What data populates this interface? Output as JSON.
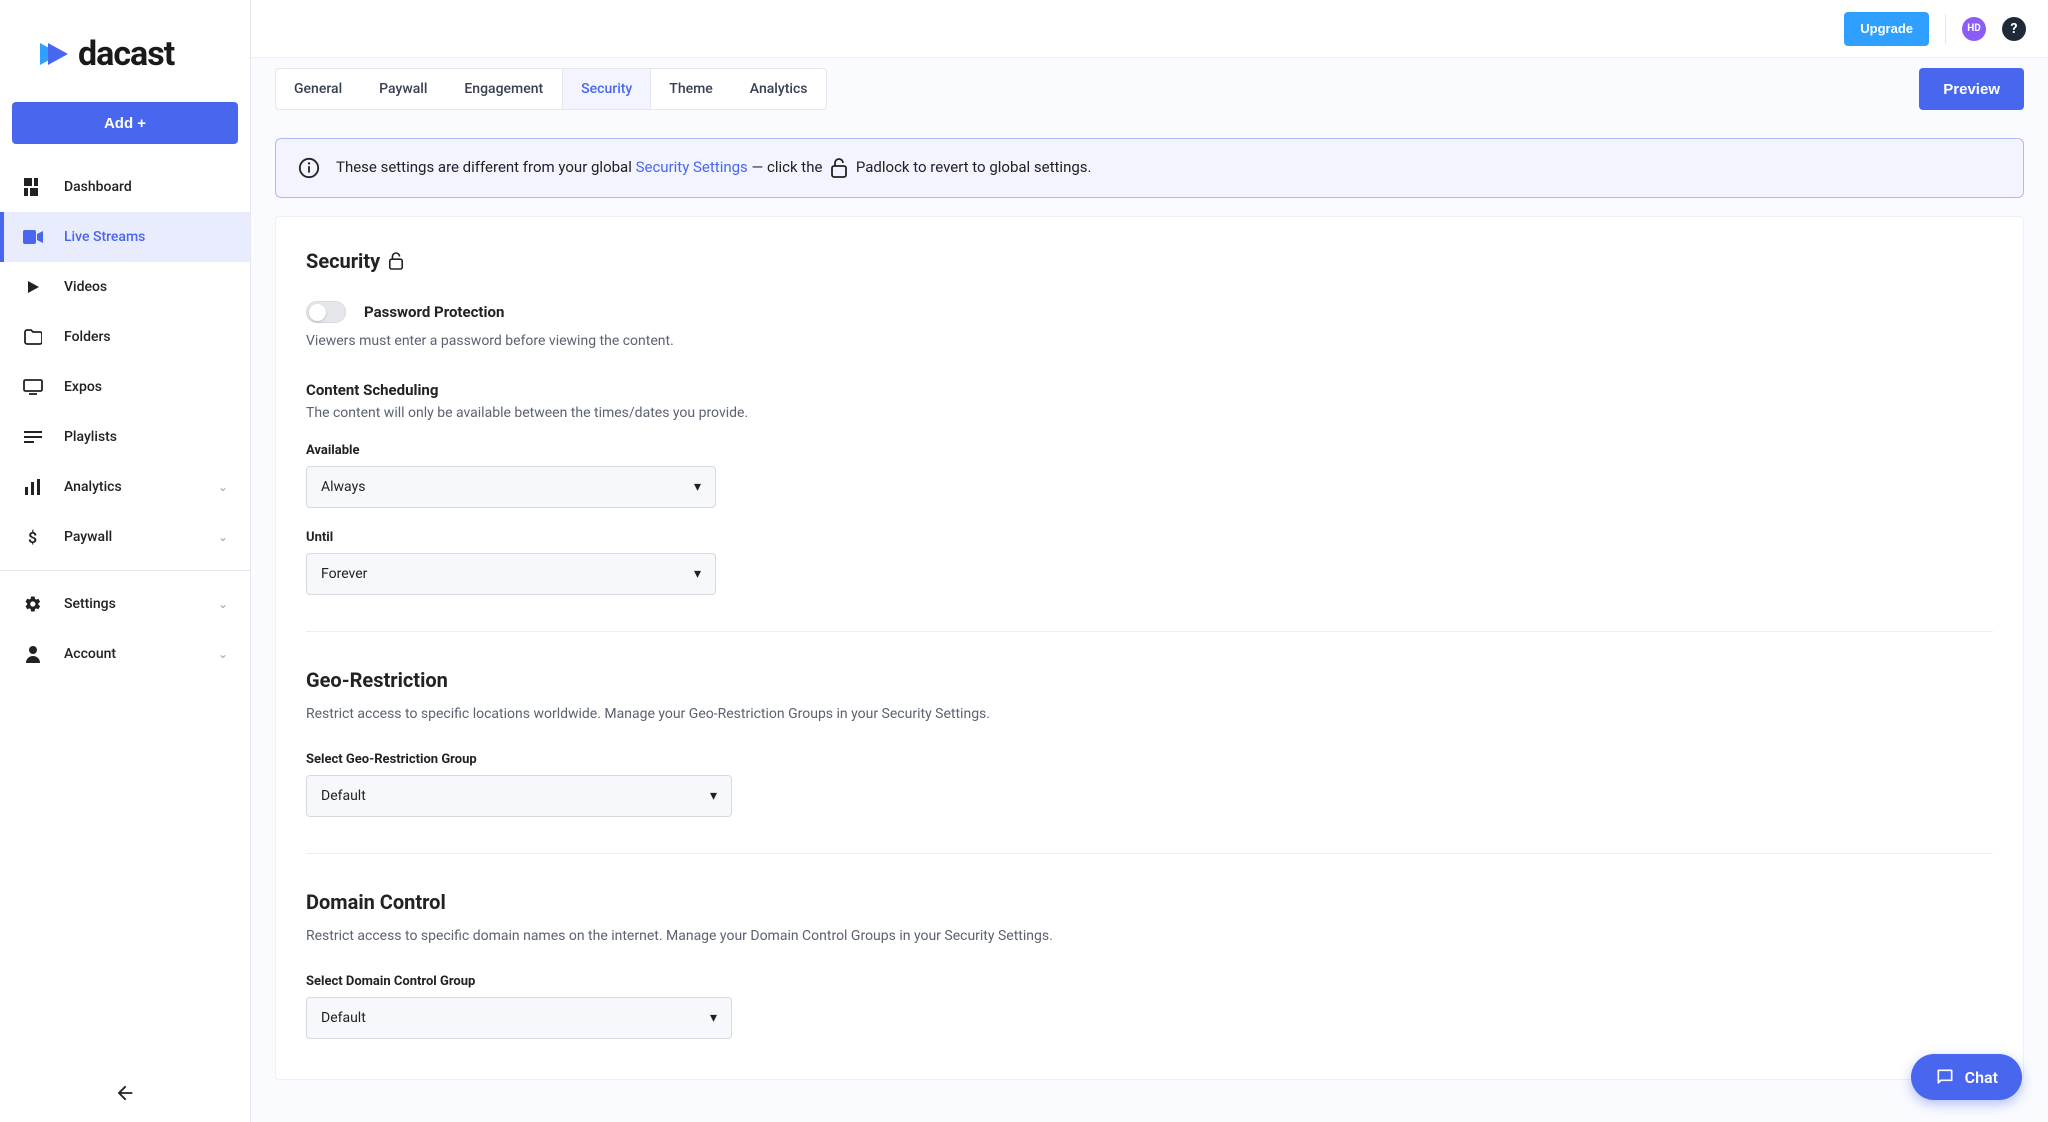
{
  "brand": {
    "name": "dacast"
  },
  "sidebar": {
    "add_label": "Add +",
    "items": [
      {
        "label": "Dashboard"
      },
      {
        "label": "Live Streams"
      },
      {
        "label": "Videos"
      },
      {
        "label": "Folders"
      },
      {
        "label": "Expos"
      },
      {
        "label": "Playlists"
      },
      {
        "label": "Analytics"
      },
      {
        "label": "Paywall"
      }
    ],
    "bottom_items": [
      {
        "label": "Settings"
      },
      {
        "label": "Account"
      }
    ]
  },
  "topbar": {
    "upgrade_label": "Upgrade",
    "avatar_initials": "HD"
  },
  "tabs": [
    {
      "label": "General"
    },
    {
      "label": "Paywall"
    },
    {
      "label": "Engagement"
    },
    {
      "label": "Security"
    },
    {
      "label": "Theme"
    },
    {
      "label": "Analytics"
    }
  ],
  "preview_label": "Preview",
  "banner": {
    "prefix": "These settings are different from your global ",
    "link": "Security Settings",
    "mid": " — click the ",
    "suffix": " Padlock to revert to global settings."
  },
  "security": {
    "heading": "Security",
    "password": {
      "title": "Password Protection",
      "desc": "Viewers must enter a password before viewing the content."
    },
    "schedule": {
      "title": "Content Scheduling",
      "desc": "The content will only be available between the times/dates you provide.",
      "available_label": "Available",
      "available_value": "Always",
      "until_label": "Until",
      "until_value": "Forever"
    },
    "geo": {
      "title": "Geo-Restriction",
      "desc": "Restrict access to specific locations worldwide. Manage your Geo-Restriction Groups in your Security Settings.",
      "select_label": "Select Geo-Restriction Group",
      "select_value": "Default"
    },
    "domain": {
      "title": "Domain Control",
      "desc": "Restrict access to specific domain names on the internet. Manage your Domain Control Groups in your Security Settings.",
      "select_label": "Select Domain Control Group",
      "select_value": "Default"
    }
  },
  "chat_label": "Chat"
}
